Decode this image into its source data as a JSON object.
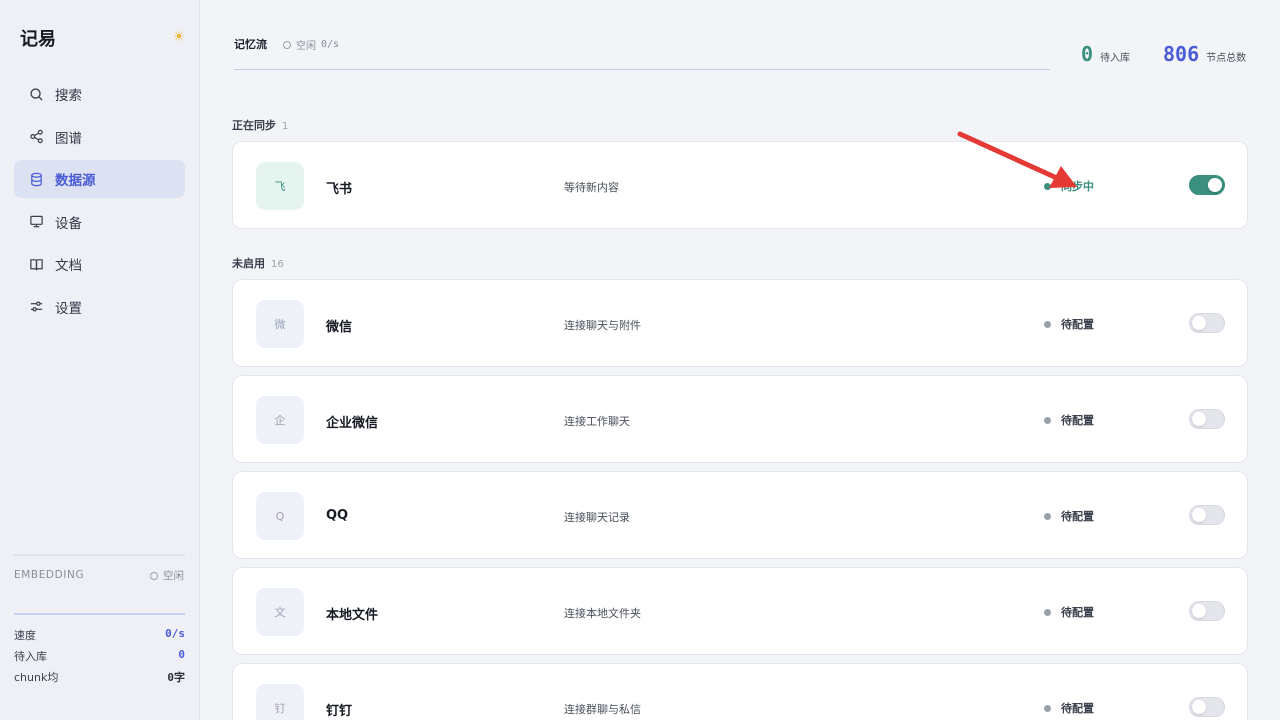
{
  "sidebar": {
    "brand": "记易",
    "brand_icon": "sun-icon",
    "items": [
      {
        "label": "搜索",
        "icon": "search-icon",
        "active": false
      },
      {
        "label": "图谱",
        "icon": "share-graph-icon",
        "active": false
      },
      {
        "label": "数据源",
        "icon": "database-icon",
        "active": true
      },
      {
        "label": "设备",
        "icon": "monitor-icon",
        "active": false
      },
      {
        "label": "文档",
        "icon": "book-icon",
        "active": false
      },
      {
        "label": "设置",
        "icon": "sliders-icon",
        "active": false
      }
    ],
    "embedding": {
      "label": "EMBEDDING",
      "status": "空闲"
    },
    "stats": [
      {
        "label": "速度",
        "value": "0/s"
      },
      {
        "label": "待入库",
        "value": "0"
      },
      {
        "label": "chunk均",
        "value": "0字"
      }
    ]
  },
  "header": {
    "tab": "记忆流",
    "status": "空闲",
    "rate": "0/s",
    "counters": [
      {
        "value": "0",
        "label": "待入库",
        "color": "#3a8f7f"
      },
      {
        "value": "806",
        "label": "节点总数",
        "color": "#4a5bd6"
      }
    ]
  },
  "sections": {
    "syncing": {
      "title": "正在同步",
      "count": "1"
    },
    "disabled": {
      "title": "未启用",
      "count": "16"
    }
  },
  "sources": [
    {
      "avatar": "飞",
      "name": "飞书",
      "desc": "等待新内容",
      "status": "同步中",
      "enabled": true
    },
    {
      "avatar": "微",
      "name": "微信",
      "desc": "连接聊天与附件",
      "status": "待配置",
      "enabled": false
    },
    {
      "avatar": "企",
      "name": "企业微信",
      "desc": "连接工作聊天",
      "status": "待配置",
      "enabled": false
    },
    {
      "avatar": "Q",
      "name": "QQ",
      "desc": "连接聊天记录",
      "status": "待配置",
      "enabled": false
    },
    {
      "avatar": "文",
      "name": "本地文件",
      "desc": "连接本地文件夹",
      "status": "待配置",
      "enabled": false
    },
    {
      "avatar": "钉",
      "name": "钉钉",
      "desc": "连接群聊与私信",
      "status": "待配置",
      "enabled": false
    }
  ],
  "colors": {
    "accent": "#4a5bd6",
    "sync_green": "#3a8f7f",
    "arrow_red": "#e53935"
  }
}
